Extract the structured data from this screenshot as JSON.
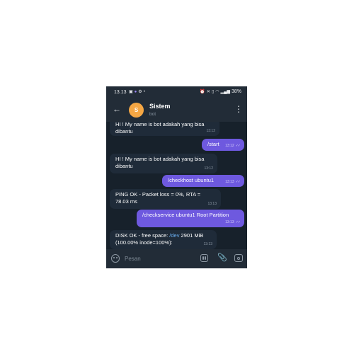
{
  "status_bar": {
    "time": "13.13",
    "battery": "38%"
  },
  "header": {
    "avatar_letter": "S",
    "title": "Sistem",
    "subtitle": "bot"
  },
  "messages": [
    {
      "dir": "in",
      "text": "HI ! My name is bot adakah yang bisa dibantu",
      "time": "13:12"
    },
    {
      "dir": "out",
      "text": "/start",
      "time": "13:12"
    },
    {
      "dir": "in",
      "text": "HI ! My name is bot adakah yang bisa dibantu",
      "time": "13:12"
    },
    {
      "dir": "out",
      "text": "/checkhost ubuntu1",
      "time": "13:13"
    },
    {
      "dir": "in",
      "text": "PING OK - Packet loss = 0%, RTA = 78.03 ms",
      "time": "13:13"
    },
    {
      "dir": "out",
      "text": "/checkservice ubuntu1 Root Partition",
      "time": "13:13"
    },
    {
      "dir": "in",
      "text_prefix": "DISK OK - free space: ",
      "text_link": "/dev",
      "text_suffix": " 2901 MiB (100.00% inode=100%):",
      "time": "13:13"
    }
  ],
  "input": {
    "placeholder": "Pesan"
  },
  "colors": {
    "header_bg": "#222c37",
    "chat_bg": "#17212b",
    "incoming_bubble": "#1f2b39",
    "outgoing_bubble": "#6e59df",
    "avatar": "#f5a744",
    "link": "#6aaef0"
  },
  "icons": [
    "back-arrow-icon",
    "more-vert-icon",
    "emoji-icon",
    "sticker-icon",
    "attach-icon",
    "camera-icon",
    "double-check-icon"
  ]
}
